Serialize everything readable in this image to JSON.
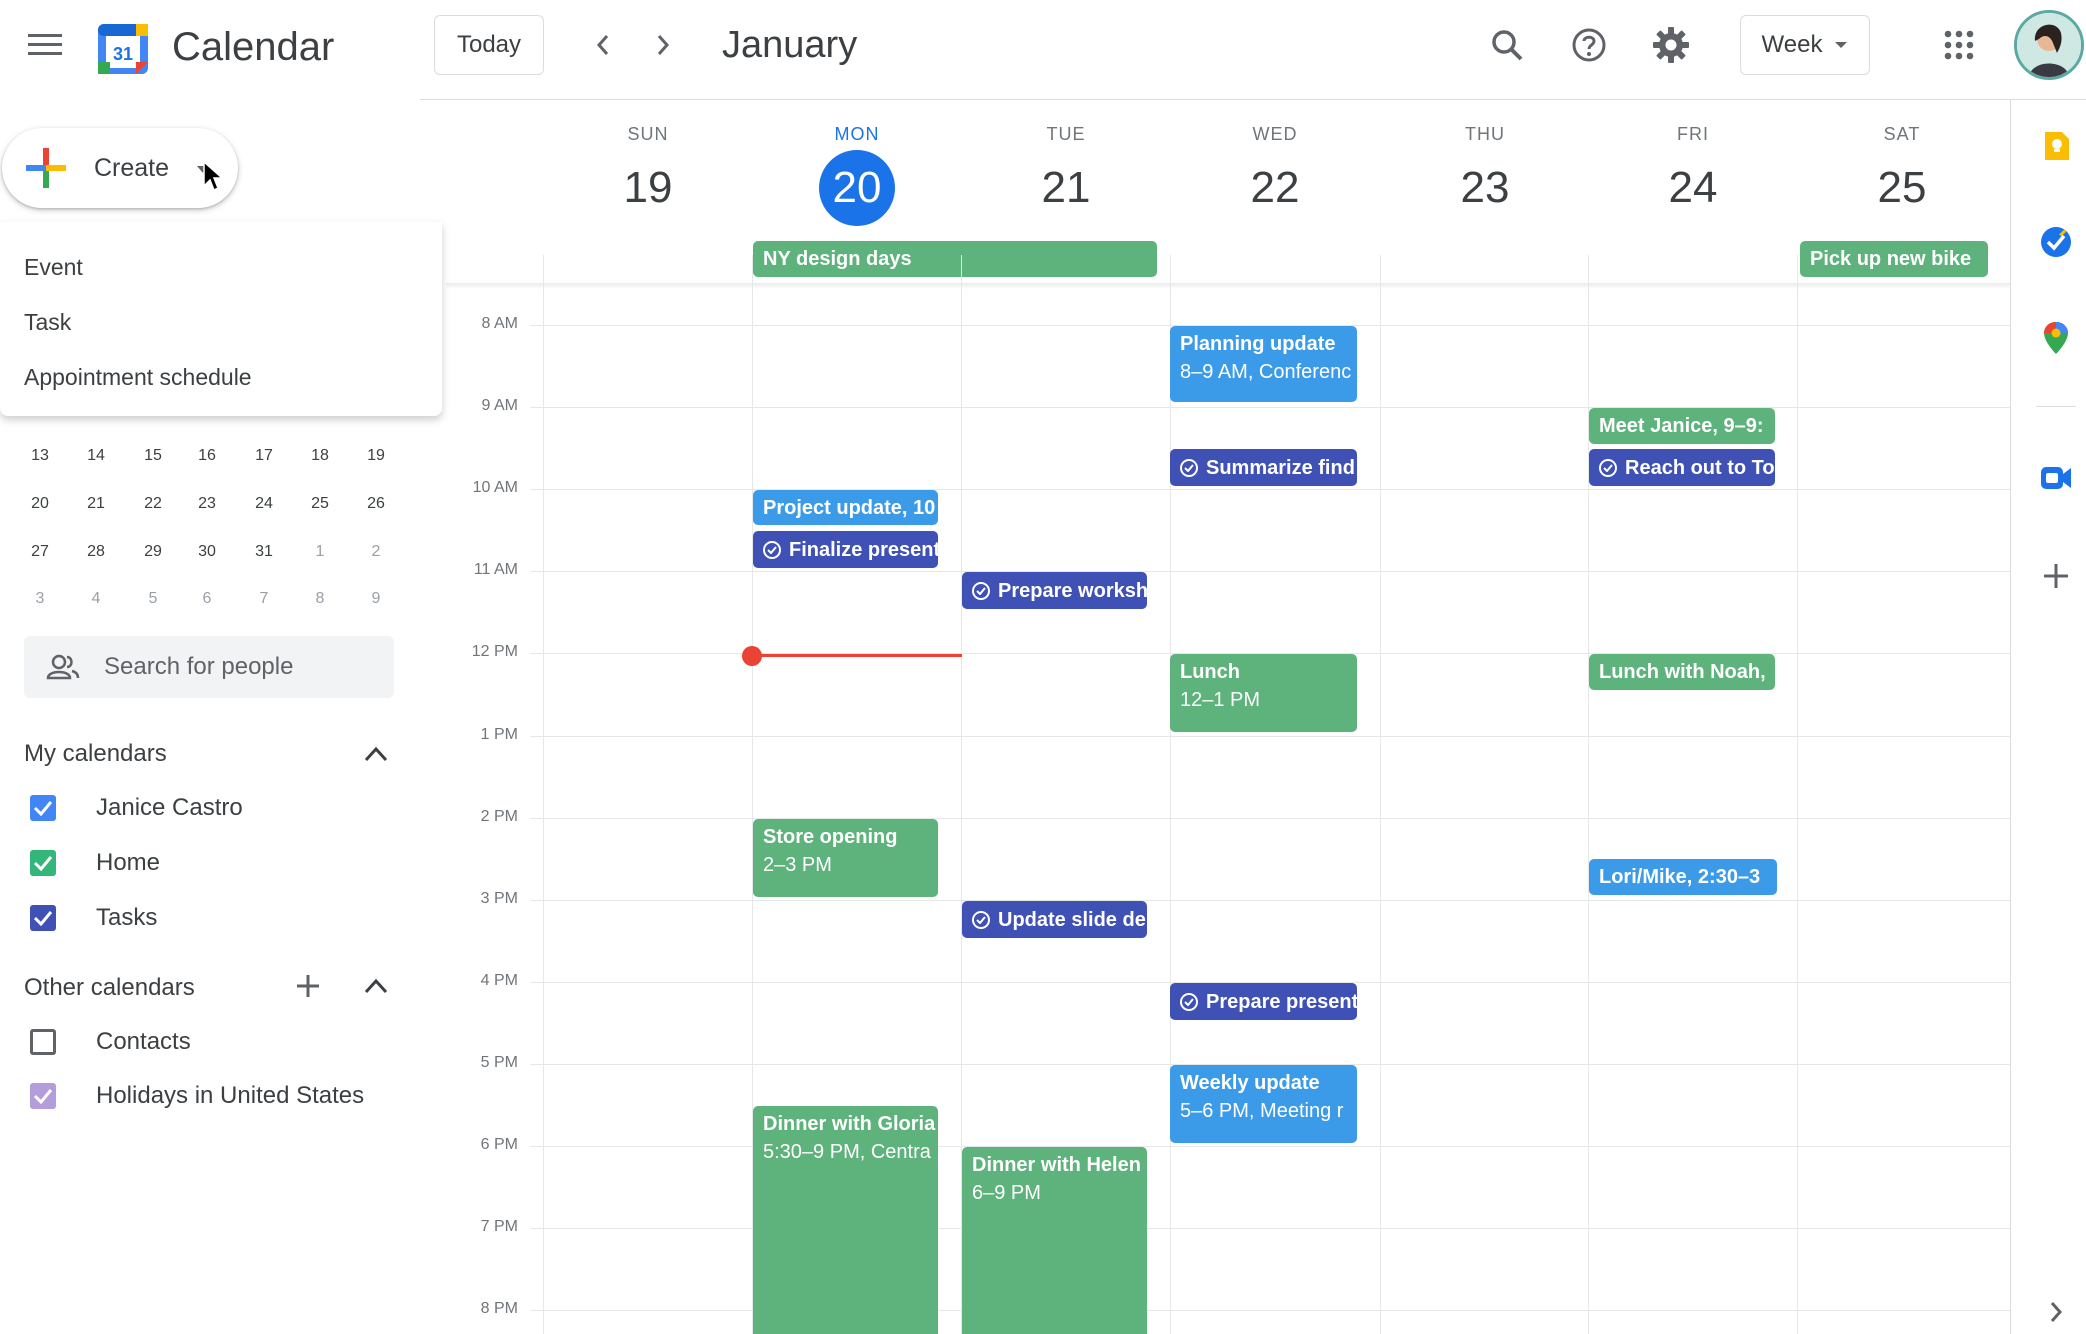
{
  "header": {
    "app_title": "Calendar",
    "logo_text": "31",
    "today_label": "Today",
    "month_title": "January",
    "view_label": "Week"
  },
  "create": {
    "label": "Create",
    "menu": [
      "Event",
      "Task",
      "Appointment schedule"
    ]
  },
  "mini_calendar": {
    "weeks": [
      [
        "13",
        "14",
        "15",
        "16",
        "17",
        "18",
        "19"
      ],
      [
        "20",
        "21",
        "22",
        "23",
        "24",
        "25",
        "26"
      ],
      [
        "27",
        "28",
        "29",
        "30",
        "31",
        "1",
        "2"
      ],
      [
        "3",
        "4",
        "5",
        "6",
        "7",
        "8",
        "9"
      ]
    ]
  },
  "people_search": {
    "placeholder": "Search for people"
  },
  "my_calendars": {
    "title": "My calendars",
    "items": [
      {
        "label": "Janice Castro",
        "color": "#4285f4",
        "checked": true
      },
      {
        "label": "Home",
        "color": "#33b679",
        "checked": true
      },
      {
        "label": "Tasks",
        "color": "#3f51b5",
        "checked": true
      }
    ]
  },
  "other_calendars": {
    "title": "Other calendars",
    "items": [
      {
        "label": "Contacts",
        "color": "#5f6368",
        "checked": false
      },
      {
        "label": "Holidays in United States",
        "color": "#b39ddb",
        "checked": true
      }
    ]
  },
  "week": {
    "days": [
      {
        "name": "SUN",
        "num": "19"
      },
      {
        "name": "MON",
        "num": "20",
        "today": true
      },
      {
        "name": "TUE",
        "num": "21"
      },
      {
        "name": "WED",
        "num": "22"
      },
      {
        "name": "THU",
        "num": "23"
      },
      {
        "name": "FRI",
        "num": "24"
      },
      {
        "name": "SAT",
        "num": "25"
      }
    ],
    "hours": [
      "8 AM",
      "9 AM",
      "10 AM",
      "11 AM",
      "12 PM",
      "1 PM",
      "2 PM",
      "3 PM",
      "4 PM",
      "5 PM",
      "6 PM",
      "7 PM",
      "8 PM"
    ]
  },
  "all_day_events": [
    {
      "title": "NY design days",
      "color": "#5eb27c"
    },
    {
      "title": "Pick up new bike",
      "color": "#5eb27c"
    }
  ],
  "events": {
    "planning_update": {
      "title": "Planning update",
      "sub": "8–9 AM, Conferenc"
    },
    "summarize": {
      "title": "Summarize find"
    },
    "meet_janice": {
      "title": "Meet Janice, 9–9:"
    },
    "reach_out": {
      "title": "Reach out to To"
    },
    "project_update": {
      "title": "Project update, 10"
    },
    "finalize": {
      "title": "Finalize present"
    },
    "prepare_workshop": {
      "title": "Prepare worksh"
    },
    "lunch": {
      "title": "Lunch",
      "sub": "12–1 PM"
    },
    "lunch_noah": {
      "title": "Lunch with Noah,"
    },
    "store_opening": {
      "title": "Store opening",
      "sub": "2–3 PM"
    },
    "lori_mike": {
      "title": "Lori/Mike, 2:30–3"
    },
    "update_slide": {
      "title": "Update slide de"
    },
    "prepare_present": {
      "title": "Prepare present"
    },
    "weekly_update": {
      "title": "Weekly update",
      "sub": "5–6 PM, Meeting r"
    },
    "dinner_gloria": {
      "title": "Dinner with Gloria",
      "sub": "5:30–9 PM, Centra"
    },
    "dinner_helen": {
      "title": "Dinner with Helen",
      "sub": "6–9 PM"
    }
  },
  "colors": {
    "accent": "#1a73e8",
    "event_green": "#5eb27c",
    "event_blue": "#3c9be8",
    "task_indigo": "#3f51b5",
    "now_line": "#ea4335"
  },
  "side_panel": [
    "keep-icon",
    "tasks-icon",
    "maps-icon",
    "meet-icon",
    "add-icon",
    "expand-icon"
  ]
}
